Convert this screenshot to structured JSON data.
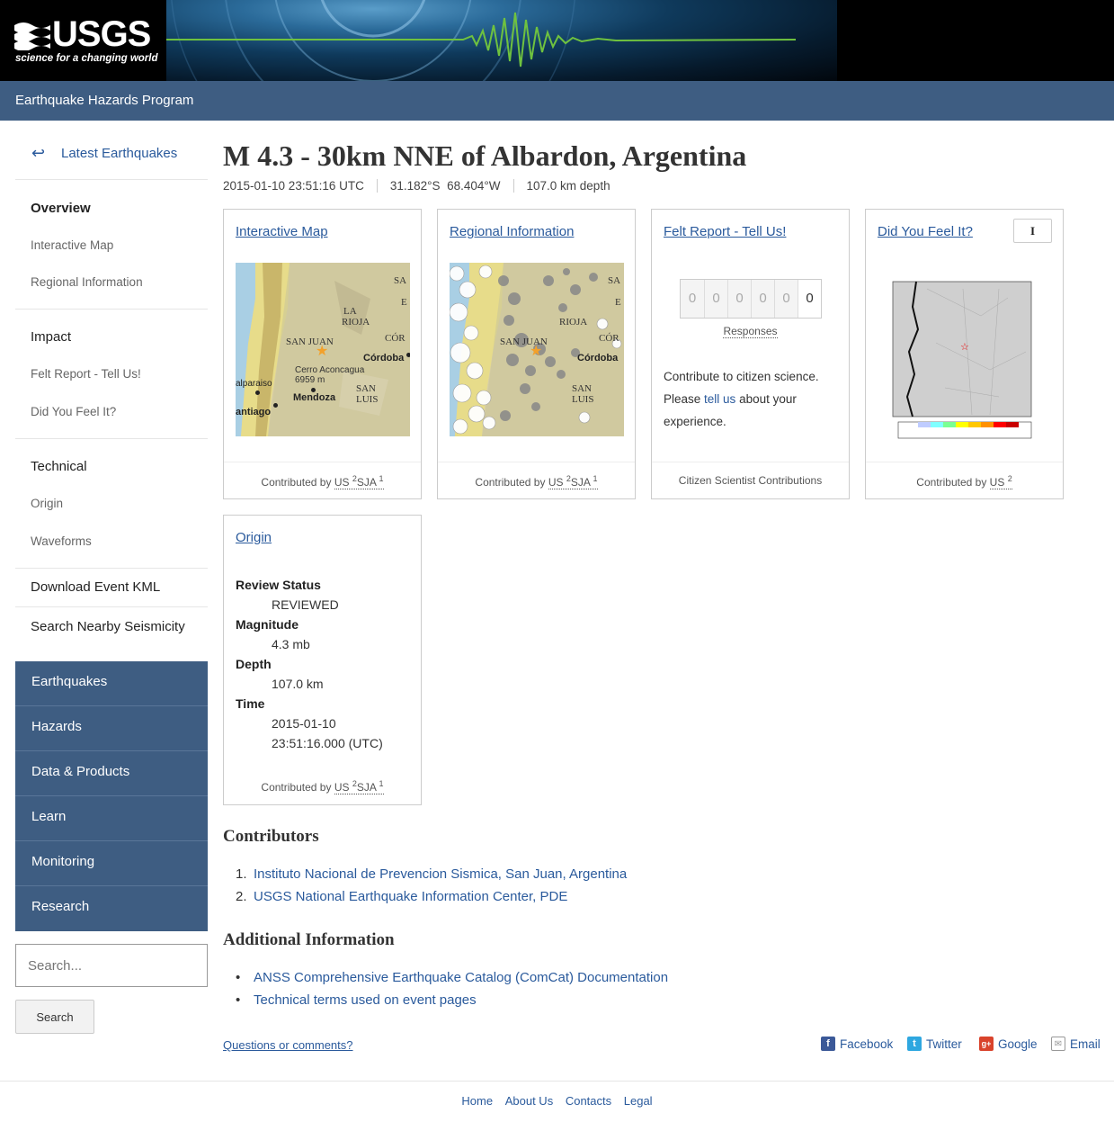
{
  "header": {
    "logo_word": "USGS",
    "logo_tagline": "science for a changing world",
    "program": "Earthquake Hazards Program"
  },
  "sidebar": {
    "back_arrow": "↩",
    "back_label": "Latest Earthquakes",
    "overview": "Overview",
    "interactive_map": "Interactive Map",
    "regional_info": "Regional Information",
    "impact": "Impact",
    "felt_report": "Felt Report - Tell Us!",
    "dyfi": "Did You Feel It?",
    "technical": "Technical",
    "origin": "Origin",
    "waveforms": "Waveforms",
    "download_kml": "Download Event KML",
    "search_nearby": "Search Nearby Seismicity",
    "site_nav": [
      "Earthquakes",
      "Hazards",
      "Data & Products",
      "Learn",
      "Monitoring",
      "Research"
    ],
    "search_placeholder": "Search...",
    "search_button": "Search"
  },
  "event": {
    "title": "M 4.3 - 30km NNE of Albardon, Argentina",
    "time": "2015-01-10 23:51:16 UTC",
    "lat": "31.182°S",
    "lon": "68.404°W",
    "depth": "107.0 km depth"
  },
  "cards": {
    "interactive_map": {
      "title": "Interactive Map",
      "contrib_prefix": "Contributed by ",
      "src1": "US",
      "sup1": "2",
      "src2": "SJA",
      "sup2": "1"
    },
    "regional_info": {
      "title": "Regional Information",
      "contrib_prefix": "Contributed by ",
      "src1": "US",
      "sup1": "2",
      "src2": "SJA",
      "sup2": "1"
    },
    "felt_report": {
      "title": "Felt Report - Tell Us!",
      "digits": [
        "0",
        "0",
        "0",
        "0",
        "0",
        "0"
      ],
      "responses": "Responses",
      "text_before": "Contribute to citizen science. Please ",
      "link": "tell us",
      "text_after": " about your experience.",
      "footer": "Citizen Scientist Contributions"
    },
    "dyfi": {
      "title": "Did You Feel It?",
      "badge": "I",
      "contrib_prefix": "Contributed by ",
      "src1": "US",
      "sup1": "2"
    },
    "origin": {
      "title": "Origin",
      "review_label": "Review Status",
      "review_value": "REVIEWED",
      "magnitude_label": "Magnitude",
      "magnitude_value": "4.3 mb",
      "depth_label": "Depth",
      "depth_value": "107.0 km",
      "time_label": "Time",
      "time_value_1": "2015-01-10",
      "time_value_2": "23:51:16.000 (UTC)",
      "contrib_prefix": "Contributed by ",
      "src1": "US",
      "sup1": "2",
      "src2": "SJA",
      "sup2": "1"
    }
  },
  "map_labels": {
    "sa": "SA",
    "e": "E",
    "la": "LA",
    "rioja": "RIOJA",
    "sanjuan": "SAN JUAN",
    "cor": "CÓR",
    "cordoba": "Córdoba",
    "aconcagua": "Cerro Aconcagua",
    "aconcagua_m": "6959 m",
    "mendoza": "Mendoza",
    "san": "SAN",
    "luis": "LUIS",
    "valparaiso": "alparaiso",
    "santiago": "antiago"
  },
  "contributors": {
    "heading": "Contributors",
    "items": [
      {
        "num": "1.",
        "label": "Instituto Nacional de Prevencion Sismica, San Juan, Argentina"
      },
      {
        "num": "2.",
        "label": "USGS National Earthquake Information Center, PDE"
      }
    ]
  },
  "additional": {
    "heading": "Additional Information",
    "items": [
      {
        "mark": "•",
        "label": "ANSS Comprehensive Earthquake Catalog (ComCat) Documentation"
      },
      {
        "mark": "•",
        "label": "Technical terms used on event pages"
      }
    ]
  },
  "share": {
    "questions": "Questions or comments?",
    "facebook": "Facebook",
    "twitter": "Twitter",
    "google": "Google",
    "email": "Email",
    "google_glyph": "g+"
  },
  "footer": {
    "links": [
      "Home",
      "About Us",
      "Contacts",
      "Legal"
    ]
  },
  "colors": {
    "nav_blue": "#3e5d82",
    "link": "#2a5a9c"
  }
}
